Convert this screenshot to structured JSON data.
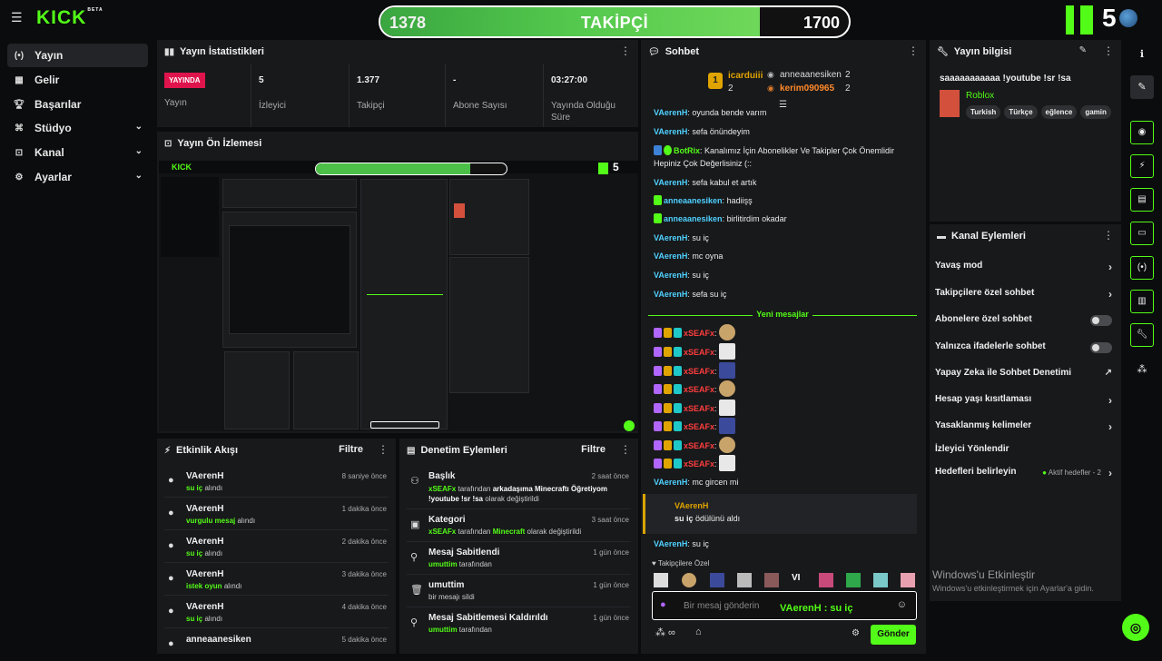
{
  "colors": {
    "accent": "#53fc18",
    "live": "#e0144c",
    "bg": "#0b0c0d",
    "panel": "#18191b"
  },
  "topbar": {
    "logo": "KICK",
    "logo_sup": "BETA",
    "goal": {
      "current": "1378",
      "label": "TAKİPÇİ",
      "target": "1700",
      "progress": 0.81
    },
    "k_number": "5"
  },
  "nav": {
    "items": [
      {
        "label": "Yayın",
        "icon": "broadcast-icon"
      },
      {
        "label": "Gelir",
        "icon": "revenue-icon"
      },
      {
        "label": "Başarılar",
        "icon": "trophy-icon"
      },
      {
        "label": "Stüdyo",
        "icon": "studio-icon"
      },
      {
        "label": "Kanal",
        "icon": "channel-icon"
      },
      {
        "label": "Ayarlar",
        "icon": "gear-icon"
      }
    ]
  },
  "stats": {
    "title": "Yayın İstatistikleri",
    "live_badge": "YAYINDA",
    "cells": [
      {
        "value": "",
        "label": "Yayın"
      },
      {
        "value": "5",
        "label": "İzleyici"
      },
      {
        "value": "1.377",
        "label": "Takipçi"
      },
      {
        "value": "-",
        "label": "Abone Sayısı"
      },
      {
        "value": "03:27:00",
        "label": "Yayında Olduğu Süre"
      }
    ]
  },
  "preview": {
    "title": "Yayın Ön İzlemesi"
  },
  "activity": {
    "title": "Etkinlik Akışı",
    "filter": "Filtre",
    "items": [
      {
        "name": "VAerenH",
        "reward": "su iç",
        "suffix": "alındı",
        "time": "8 saniye önce"
      },
      {
        "name": "VAerenH",
        "reward": "vurgulu mesaj",
        "suffix": "alındı",
        "time": "1 dakika önce"
      },
      {
        "name": "VAerenH",
        "reward": "su iç",
        "suffix": "alındı",
        "time": "2 dakika önce"
      },
      {
        "name": "VAerenH",
        "reward": "istek oyun",
        "suffix": "alındı",
        "time": "3 dakika önce"
      },
      {
        "name": "VAerenH",
        "reward": "su iç",
        "suffix": "alındı",
        "time": "4 dakika önce"
      },
      {
        "name": "anneaanesiken",
        "reward": "",
        "suffix": "",
        "time": "5 dakika önce"
      }
    ]
  },
  "moderation": {
    "title": "Denetim Eylemleri",
    "filter": "Filtre",
    "items": [
      {
        "title": "Başlık",
        "user": "xSEAFx",
        "mid": "tarafından",
        "bold": "arkadaşıma Minecraftı Öğretiyom !youtube !sr !sa",
        "end": "olarak değiştirildi",
        "time": "2 saat önce"
      },
      {
        "title": "Kategori",
        "user": "xSEAFx",
        "mid": "tarafından",
        "bold": "Minecraft",
        "end": "olarak değiştirildi",
        "time": "3 saat önce"
      },
      {
        "title": "Mesaj Sabitlendi",
        "user": "umuttim",
        "mid": "tarafından",
        "bold": "",
        "end": "",
        "time": "1 gün önce"
      },
      {
        "title": "umuttim",
        "user": "",
        "mid": "bir mesajı sildi",
        "bold": "",
        "end": "",
        "time": "1 gün önce"
      },
      {
        "title": "Mesaj Sabitlemesi Kaldırıldı",
        "user": "umuttim",
        "mid": "tarafından",
        "bold": "",
        "end": "",
        "time": "1 gün önce"
      }
    ]
  },
  "chat": {
    "title": "Sohbet",
    "leaderboard": [
      {
        "rank": "1",
        "name": "icarduiii",
        "count": "2"
      },
      {
        "name": "anneaanesiken",
        "count": "2"
      },
      {
        "name": "kerim090965",
        "count": "2"
      }
    ],
    "messages": [
      {
        "user": "VAerenH",
        "text": "oyunda bende varım"
      },
      {
        "user": "VAerenH",
        "text": "sefa önündeyim"
      },
      {
        "user": "BotRix",
        "text": "Kanalımız İçin Abonelikler Ve Takipler Çok Önemlidir Hepiniz Çok Değerlisiniz (::"
      },
      {
        "user": "VAerenH",
        "text": "sefa kabul et artık"
      },
      {
        "user": "anneaanesiken",
        "text": "hadiişş"
      },
      {
        "user": "anneaanesiken",
        "text": "birlitirdim okadar"
      },
      {
        "user": "VAerenH",
        "text": "su iç"
      },
      {
        "user": "VAerenH",
        "text": "mc oyna"
      },
      {
        "user": "VAerenH",
        "text": "su iç"
      },
      {
        "user": "VAerenH",
        "text": "sefa su iç"
      }
    ],
    "new_messages": "Yeni mesajlar",
    "spam_user": "xSEAFx",
    "after_spam": {
      "user": "VAerenH",
      "text": "mc gircen mi"
    },
    "reward": {
      "user": "VAerenH",
      "reward": "su iç",
      "text": "ödülünü aldı"
    },
    "last": {
      "user": "VAerenH",
      "text": "su iç"
    },
    "followers_only": "Takipçilere Özel",
    "input_placeholder": "Bir mesaj gönderin",
    "overlay": "VAerenH : su iç",
    "send": "Gönder"
  },
  "stream_info": {
    "title": "Yayın bilgisi",
    "stream_title": "saaaaaaaaaaa !youtube !sr !sa",
    "category": "Roblox",
    "tags": [
      "Turkish",
      "Türkçe",
      "eğlence",
      "gamin"
    ]
  },
  "channel_actions": {
    "title": "Kanal Eylemleri",
    "items": [
      {
        "label": "Yavaş mod",
        "type": "chevron"
      },
      {
        "label": "Takipçilere özel sohbet",
        "type": "chevron"
      },
      {
        "label": "Abonelere özel sohbet",
        "type": "toggle"
      },
      {
        "label": "Yalnızca ifadelerle sohbet",
        "type": "toggle"
      },
      {
        "label": "Yapay Zeka ile Sohbet Denetimi",
        "type": "external"
      },
      {
        "label": "Hesap yaşı kısıtlaması",
        "type": "chevron"
      },
      {
        "label": "Yasaklanmış kelimeler",
        "type": "chevron"
      },
      {
        "label": "İzleyici Yönlendir",
        "type": "none"
      },
      {
        "label": "Hedefleri belirleyin",
        "type": "chevron",
        "extra": "Aktif hedefler - 2"
      }
    ]
  },
  "watermark": {
    "line1": "Windows'u Etkinleştir",
    "line2": "Windows'u etkinleştirmek için Ayarlar'a gidin."
  }
}
